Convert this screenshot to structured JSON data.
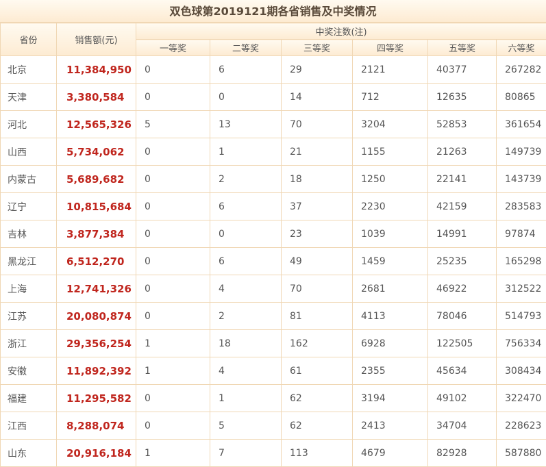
{
  "title": "双色球第2019121期各省销售及中奖情况",
  "headers": {
    "province": "省份",
    "sales": "销售额(元)",
    "group": "中奖注数(注)",
    "levels": [
      "一等奖",
      "二等奖",
      "三等奖",
      "四等奖",
      "五等奖",
      "六等奖"
    ]
  },
  "rows": [
    {
      "province": "北京",
      "sales": "11,384,950",
      "counts": [
        "0",
        "6",
        "29",
        "2121",
        "40377",
        "267282"
      ]
    },
    {
      "province": "天津",
      "sales": "3,380,584",
      "counts": [
        "0",
        "0",
        "14",
        "712",
        "12635",
        "80865"
      ]
    },
    {
      "province": "河北",
      "sales": "12,565,326",
      "counts": [
        "5",
        "13",
        "70",
        "3204",
        "52853",
        "361654"
      ]
    },
    {
      "province": "山西",
      "sales": "5,734,062",
      "counts": [
        "0",
        "1",
        "21",
        "1155",
        "21263",
        "149739"
      ]
    },
    {
      "province": "内蒙古",
      "sales": "5,689,682",
      "counts": [
        "0",
        "2",
        "18",
        "1250",
        "22141",
        "143739"
      ]
    },
    {
      "province": "辽宁",
      "sales": "10,815,684",
      "counts": [
        "0",
        "6",
        "37",
        "2230",
        "42159",
        "283583"
      ]
    },
    {
      "province": "吉林",
      "sales": "3,877,384",
      "counts": [
        "0",
        "0",
        "23",
        "1039",
        "14991",
        "97874"
      ]
    },
    {
      "province": "黑龙江",
      "sales": "6,512,270",
      "counts": [
        "0",
        "6",
        "49",
        "1459",
        "25235",
        "165298"
      ]
    },
    {
      "province": "上海",
      "sales": "12,741,326",
      "counts": [
        "0",
        "4",
        "70",
        "2681",
        "46922",
        "312522"
      ]
    },
    {
      "province": "江苏",
      "sales": "20,080,874",
      "counts": [
        "0",
        "2",
        "81",
        "4113",
        "78046",
        "514793"
      ]
    },
    {
      "province": "浙江",
      "sales": "29,356,254",
      "counts": [
        "1",
        "18",
        "162",
        "6928",
        "122505",
        "756334"
      ]
    },
    {
      "province": "安徽",
      "sales": "11,892,392",
      "counts": [
        "1",
        "4",
        "61",
        "2355",
        "45634",
        "308434"
      ]
    },
    {
      "province": "福建",
      "sales": "11,295,582",
      "counts": [
        "0",
        "1",
        "62",
        "3194",
        "49102",
        "322470"
      ]
    },
    {
      "province": "江西",
      "sales": "8,288,074",
      "counts": [
        "0",
        "5",
        "62",
        "2413",
        "34704",
        "228623"
      ]
    },
    {
      "province": "山东",
      "sales": "20,916,184",
      "counts": [
        "1",
        "7",
        "113",
        "4679",
        "82928",
        "587880"
      ]
    }
  ]
}
